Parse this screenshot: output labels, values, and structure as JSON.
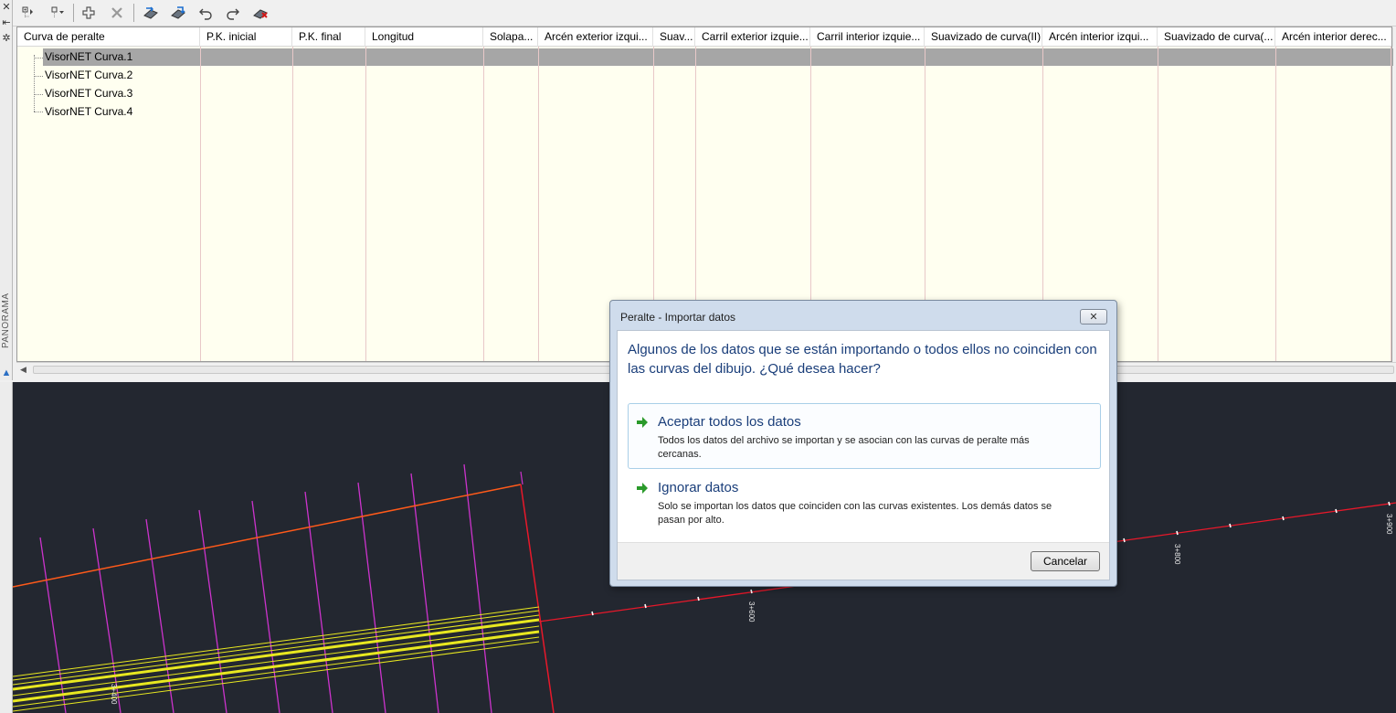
{
  "grid": {
    "columns": [
      "Curva de peralte",
      "P.K. inicial",
      "P.K. final",
      "Longitud",
      "Solapa...",
      "Arcén exterior izqui...",
      "Suav...",
      "Carril exterior izquie...",
      "Carril interior izquie...",
      "Suavizado de curva(II)",
      "Arcén interior izqui...",
      "Suavizado de curva(...",
      "Arcén interior derec..."
    ],
    "rows": [
      "VisorNET Curva.1",
      "VisorNET Curva.2",
      "VisorNET Curva.3",
      "VisorNET Curva.4"
    ]
  },
  "side_panel": {
    "label": "PANORAMA"
  },
  "cad": {
    "station_labels": [
      "3+400",
      "3+600",
      "3+800",
      "3+900"
    ],
    "colors": {
      "background": "#232730",
      "alignment": "#e8182a",
      "stations": "#cc33cc",
      "edge": "#ff5a1a",
      "lanes": "#e8e820"
    }
  },
  "dialog": {
    "title": "Peralte - Importar datos",
    "question": "Algunos de los datos que se están importando o todos ellos no coinciden con las curvas del dibujo. ¿Qué desea hacer?",
    "option1": {
      "title": "Aceptar todos los datos",
      "description": "Todos los datos del archivo se importan y se asocian con las curvas de peralte más cercanas."
    },
    "option2": {
      "title": "Ignorar datos",
      "description": "Solo se importan los datos que coinciden con las curvas existentes. Los demás datos se pasan por alto."
    },
    "cancel": "Cancelar"
  }
}
